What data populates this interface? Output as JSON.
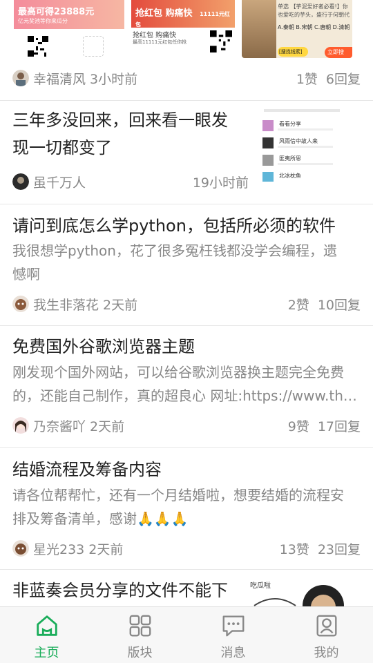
{
  "top_post": {
    "banner1": {
      "headline": "最高可得23888元",
      "sub": "亿元奖池等你来瓜分"
    },
    "banner2": {
      "headline": "抢红包 购痛快",
      "badge": "11111元红包",
      "caption": "抢红包 购痛快",
      "fine_print": "最高11111元红包任你抢"
    },
    "banner3": {
      "question": "单选 【芋泥爱好者必看!】你也爱吃的芋头，盛行于何朝代",
      "options": "A.秦朝 B.宋朝 C.唐朝 D.清朝",
      "cta": "立即搜",
      "search_hint": "[搜找线索]"
    },
    "author": "幸福清风",
    "time": "3小时前",
    "likes": "1赞",
    "replies": "6回复"
  },
  "posts": [
    {
      "title_line1": "三年多没回来，回来看一眼发",
      "title_line2": "现一切都变了",
      "author": "虽千万人",
      "time": "19小时前",
      "thumb_rows": [
        "看看分享",
        "风雨信中故人来",
        "匪夷所思",
        "北冰枕鱼"
      ]
    },
    {
      "title": "请问到底怎么学python，包括所必须的软件",
      "snippet_line1": "我很想学python，花了很多冤枉钱都没学会编程，遗",
      "snippet_line2": "憾啊",
      "author": "我生非落花",
      "time": "2天前",
      "likes": "2赞",
      "replies": "10回复"
    },
    {
      "title": "免费国外谷歌浏览器主题",
      "snippet_line1": "刚发现个国外网站，可以给谷歌浏览器换主题完全免费",
      "snippet_line2": "的，还能自己制作，真的超良心 网址:https://www.th…",
      "author": "乃奈酱吖",
      "time": "2天前",
      "likes": "9赞",
      "replies": "17回复"
    },
    {
      "title": "结婚流程及筹备内容",
      "snippet_line1": "请各位帮帮忙，还有一个月结婚啦，想要结婚的流程安",
      "snippet_line2": "排及筹备清单，感谢🙏🙏🙏",
      "author": "星光233",
      "time": "2天前",
      "likes": "13赞",
      "replies": "23回复"
    },
    {
      "title": "非蓝奏会员分享的文件不能下",
      "thumb_text": "吃瓜啦"
    }
  ],
  "tabbar": {
    "items": [
      {
        "label": "主页",
        "icon": "home-icon",
        "active": true
      },
      {
        "label": "版块",
        "icon": "grid-icon",
        "active": false
      },
      {
        "label": "消息",
        "icon": "message-icon",
        "active": false
      },
      {
        "label": "我的",
        "icon": "profile-icon",
        "active": false
      }
    ]
  },
  "colors": {
    "accent": "#1aad5a",
    "meta": "#888888",
    "divider": "#e6e6e6"
  }
}
